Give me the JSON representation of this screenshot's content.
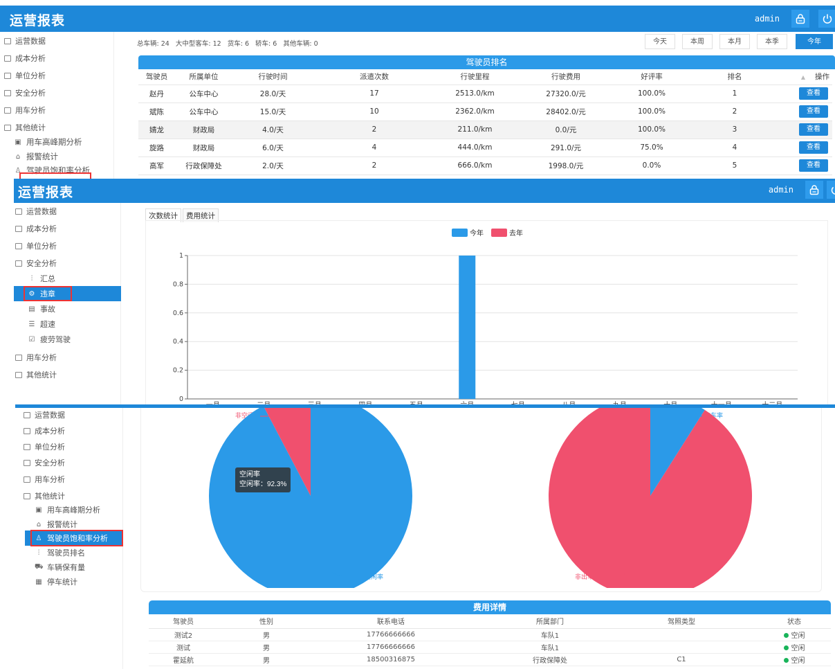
{
  "colors": {
    "primary": "#1e88d9",
    "this_year": "#2b9ae8",
    "last_year": "#f0506e",
    "red_box": "#e33333"
  },
  "icons": {
    "lock": "lock-icon",
    "power": "power-icon"
  },
  "panel1": {
    "app_title": "运营报表",
    "user": "admin",
    "sidebar": [
      "运营数据",
      "成本分析",
      "单位分析",
      "安全分析",
      "用车分析",
      "其他统计"
    ],
    "sidebar_sub": [
      "用车高峰期分析",
      "报警统计",
      "驾驶员饱和率分析"
    ],
    "summary": "总车辆: 24   大中型客车: 12   货车: 6   轿车: 6   其他车辆: 0",
    "periods": [
      "今天",
      "本周",
      "本月",
      "本季",
      "今年"
    ],
    "active_period": "今年",
    "table_title": "驾驶员排名",
    "headers": [
      "驾驶员",
      "所属单位",
      "行驶时间",
      "派遣次数",
      "行驶里程",
      "行驶费用",
      "好评率",
      "排名",
      "操作"
    ],
    "view_label": "查看",
    "rows": [
      [
        "赵丹",
        "公车中心",
        "28.0/天",
        "17",
        "2513.0/km",
        "27320.0/元",
        "100.0%",
        "1"
      ],
      [
        "斌陈",
        "公车中心",
        "15.0/天",
        "10",
        "2362.0/km",
        "28402.0/元",
        "100.0%",
        "2"
      ],
      [
        "婧龙",
        "财政局",
        "4.0/天",
        "2",
        "211.0/km",
        "0.0/元",
        "100.0%",
        "3"
      ],
      [
        "旋路",
        "财政局",
        "6.0/天",
        "4",
        "444.0/km",
        "291.0/元",
        "75.0%",
        "4"
      ],
      [
        "高军",
        "行政保障处",
        "2.0/天",
        "2",
        "666.0/km",
        "1998.0/元",
        "0.0%",
        "5"
      ]
    ]
  },
  "panel2": {
    "app_title": "运营报表",
    "user": "admin",
    "sidebar": [
      "运营数据",
      "成本分析",
      "单位分析",
      "安全分析"
    ],
    "sidebar_sub": [
      "汇总",
      "违章",
      "事故",
      "超速",
      "疲劳驾驶"
    ],
    "sidebar_after": [
      "用车分析",
      "其他统计"
    ],
    "tabs": [
      "次数统计",
      "费用统计"
    ]
  },
  "panel3": {
    "sidebar": [
      "运营数据",
      "成本分析",
      "单位分析",
      "安全分析",
      "用车分析",
      "其他统计"
    ],
    "sidebar_sub": [
      "用车高峰期分析",
      "报警统计",
      "驾驶员饱和率分析",
      "驾驶员排名",
      "车辆保有量",
      "停车统计"
    ],
    "pie1_labels": {
      "small": "非空闲",
      "large": "空闲率"
    },
    "tooltip": {
      "title": "空闲率",
      "line": "空闲率：92.3%"
    },
    "pie2_labels": {
      "small": "出车率",
      "large": "非出车"
    },
    "detail_title": "费用详情",
    "detail_headers": [
      "驾驶员",
      "性别",
      "联系电话",
      "所属部门",
      "驾照类型",
      "状态"
    ],
    "detail_rows": [
      [
        "测试2",
        "男",
        "17766666666",
        "车队1",
        "",
        "空闲"
      ],
      [
        "测试",
        "男",
        "17766666666",
        "车队1",
        "",
        "空闲"
      ],
      [
        "霍延航",
        "男",
        "18500316875",
        "行政保障处",
        "C1",
        "空闲"
      ]
    ]
  },
  "chart_data": [
    {
      "type": "bar",
      "legend": [
        "今年",
        "去年"
      ],
      "ylim": [
        0,
        1
      ],
      "yticks": [
        "0",
        "0.2",
        "0.4",
        "0.6",
        "0.8",
        "1"
      ],
      "categories": [
        "一月",
        "二月",
        "三月",
        "四月",
        "五月",
        "六月",
        "七月",
        "八月",
        "九月",
        "十月",
        "十一月",
        "十二月"
      ],
      "series": [
        {
          "name": "今年",
          "values": [
            0,
            0,
            0,
            0,
            0,
            1,
            0,
            0,
            0,
            0,
            0,
            0
          ]
        },
        {
          "name": "去年",
          "values": [
            0,
            0,
            0,
            0,
            0,
            0,
            0,
            0,
            0,
            0,
            0,
            0
          ]
        }
      ]
    },
    {
      "type": "pie",
      "values": [
        92.3,
        7.7
      ],
      "labels": [
        "空闲率",
        "非空闲"
      ]
    },
    {
      "type": "pie",
      "values": [
        9,
        91
      ],
      "labels": [
        "出车率",
        "非出车"
      ]
    }
  ]
}
